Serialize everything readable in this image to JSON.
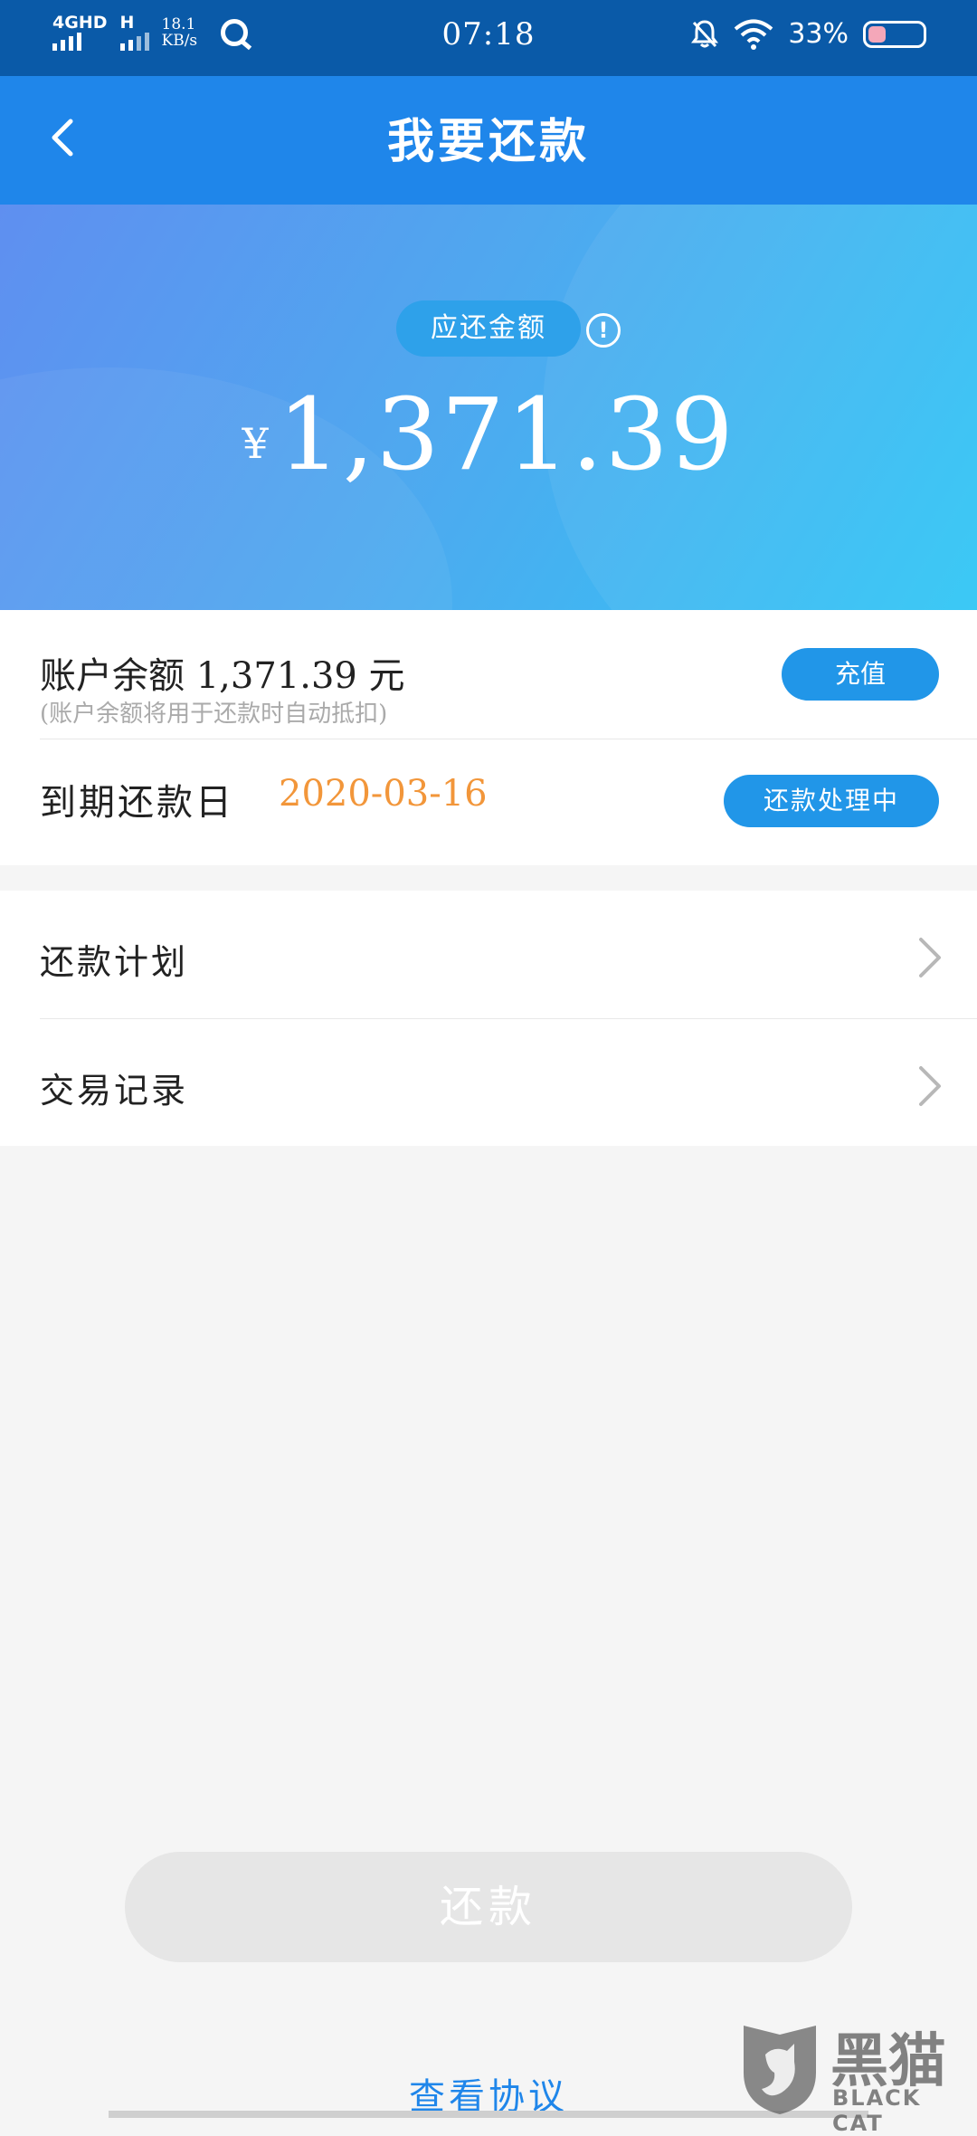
{
  "status_bar": {
    "network": "4GHD",
    "network2": "H",
    "speed_value": "18.1",
    "speed_unit": "KB/s",
    "time": "07:18",
    "battery_text": "33%",
    "battery_level": 0.33
  },
  "header": {
    "title": "我要还款"
  },
  "hero": {
    "due_label": "应还金额",
    "currency": "¥",
    "amount": "1,371.39"
  },
  "account": {
    "balance_text": "账户余额 1,371.39 元",
    "balance_note": "(账户余额将用于还款时自动抵扣)",
    "recharge_label": "充值",
    "due_date_label": "到期还款日",
    "due_date": "2020-03-16",
    "status_label": "还款处理中"
  },
  "menu": {
    "items": [
      {
        "label": "还款计划"
      },
      {
        "label": "交易记录"
      }
    ]
  },
  "actions": {
    "repay_label": "还款",
    "agreement_label": "查看协议"
  },
  "watermark": {
    "cn": "黑猫",
    "en": "BLACK CAT"
  },
  "colors": {
    "status_bar": "#0a5aa8",
    "header": "#1f86ea",
    "accent_button": "#2196e8",
    "due_date": "#f2963a",
    "disabled_button": "#e6e6e6"
  }
}
